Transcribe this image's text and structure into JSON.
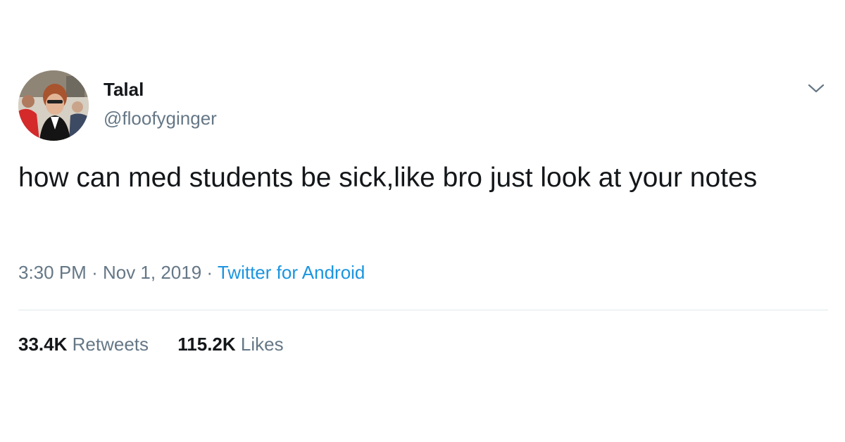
{
  "user": {
    "display_name": "Talal",
    "handle": "@floofyginger",
    "avatar_icon": "user-photo"
  },
  "tweet": {
    "text": "how can med students be sick,like bro just look at your notes"
  },
  "meta": {
    "time": "3:30 PM",
    "separator": "·",
    "date": "Nov 1, 2019",
    "source": "Twitter for Android"
  },
  "stats": {
    "retweets_count": "33.4K",
    "retweets_label": "Retweets",
    "likes_count": "115.2K",
    "likes_label": "Likes"
  },
  "colors": {
    "text": "#14171a",
    "muted": "#657786",
    "link": "#1b95e0",
    "divider": "#e1e8ed"
  }
}
